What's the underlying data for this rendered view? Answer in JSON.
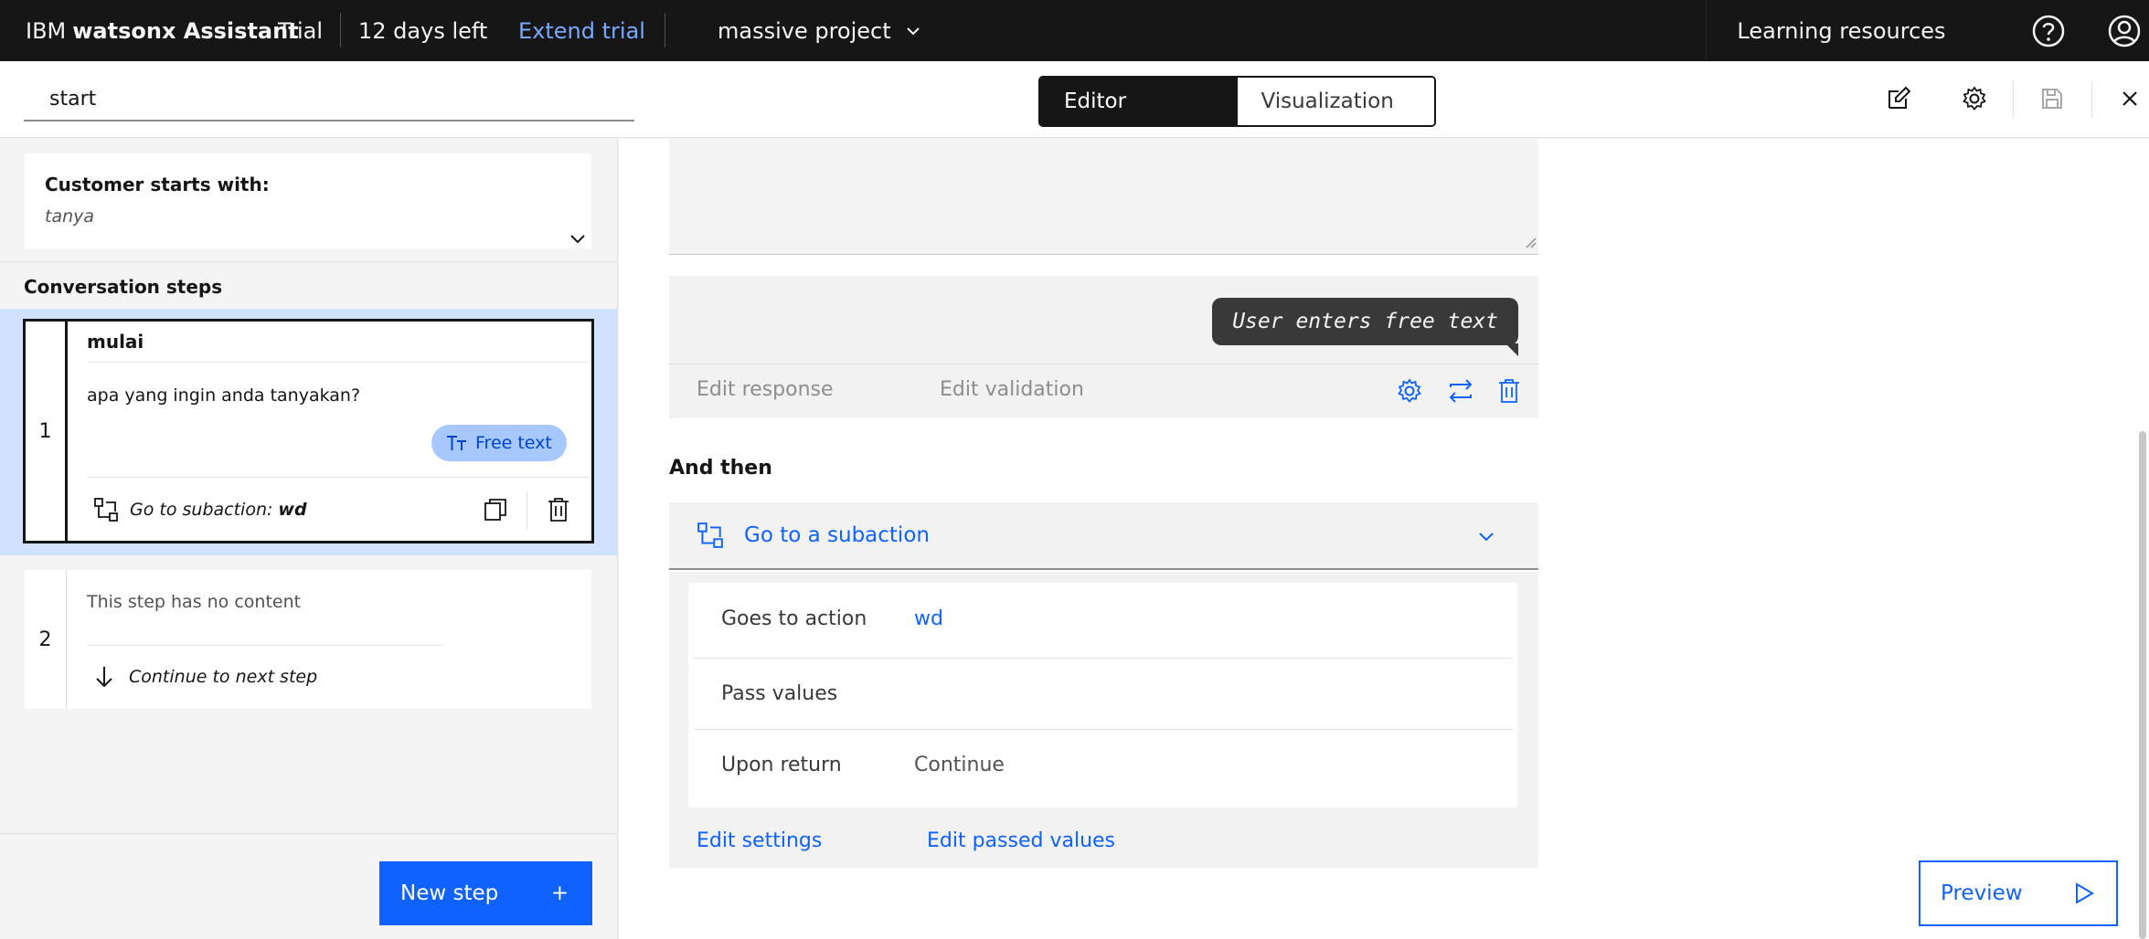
{
  "topbar": {
    "brand_ibm": "IBM",
    "brand_product": "watsonx Assistant",
    "trial": "Trial",
    "days_left": "12 days left",
    "extend_trial": "Extend trial",
    "project": "massive project",
    "learning_resources": "Learning resources"
  },
  "header": {
    "action_name": "start",
    "tabs": [
      {
        "label": "Editor",
        "active": true
      },
      {
        "label": "Visualization",
        "active": false
      }
    ]
  },
  "left": {
    "customer_starts_title": "Customer starts with:",
    "customer_starts_value": "tanya",
    "conversation_steps_title": "Conversation steps",
    "steps": [
      {
        "number": "1",
        "title": "mulai",
        "text": "apa yang ingin anda tanyakan?",
        "tag": "Free text",
        "action_prefix": "Go to subaction:",
        "action_target": "wd"
      },
      {
        "number": "2",
        "text": "This step has no content",
        "action": "Continue to next step"
      }
    ],
    "new_step_label": "New step",
    "new_step_icon": "+"
  },
  "editor": {
    "response_bubble": "User enters free text",
    "edit_response": "Edit response",
    "edit_validation": "Edit validation",
    "and_then": "And then",
    "subaction_label": "Go to a subaction",
    "details": {
      "goes_to_action_label": "Goes to action",
      "goes_to_action_value": "wd",
      "pass_values_label": "Pass values",
      "upon_return_label": "Upon return",
      "upon_return_value": "Continue"
    },
    "edit_settings": "Edit settings",
    "edit_passed_values": "Edit passed values",
    "preview": "Preview"
  },
  "colors": {
    "accent": "#0f62fe",
    "topbar_bg": "#161616",
    "selected_step_bg": "#d0e2ff",
    "tag_bg": "#a6c8ff"
  }
}
